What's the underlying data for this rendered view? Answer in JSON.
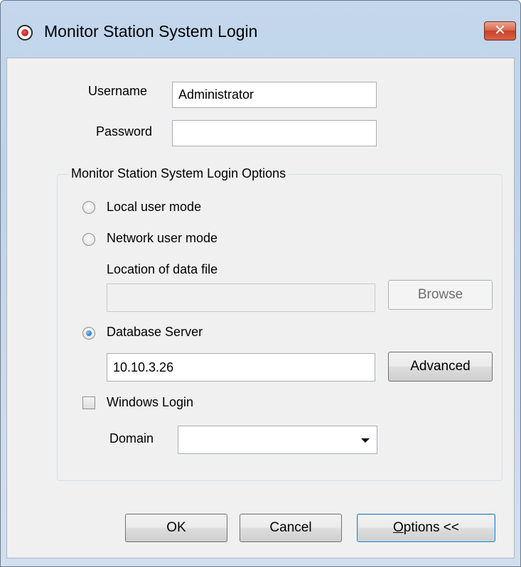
{
  "window": {
    "title": "Monitor Station System Login",
    "close_glyph": "✕",
    "icon": "eye-icon"
  },
  "credentials": {
    "username_label": "Username",
    "username_value": "Administrator",
    "password_label": "Password",
    "password_value": ""
  },
  "options_group": {
    "legend": "Monitor Station System Login Options",
    "local_user_mode_label": "Local user mode",
    "network_user_mode_label": "Network user mode",
    "data_file_label": "Location of data file",
    "data_file_value": "",
    "browse_label": "Browse",
    "database_server_label": "Database Server",
    "database_server_value": "10.10.3.26",
    "advanced_label": "Advanced",
    "windows_login_label": "Windows Login",
    "domain_label": "Domain",
    "domain_value": "",
    "selected_mode": "Database Server",
    "windows_login_checked": false
  },
  "buttons": {
    "ok": "OK",
    "cancel": "Cancel",
    "options_mnemonic": "O",
    "options_rest": "ptions <<"
  },
  "colors": {
    "title_gradient_top": "#c4d7ec",
    "close_button": "#c7432a",
    "default_button_border": "#3c7fb1"
  }
}
